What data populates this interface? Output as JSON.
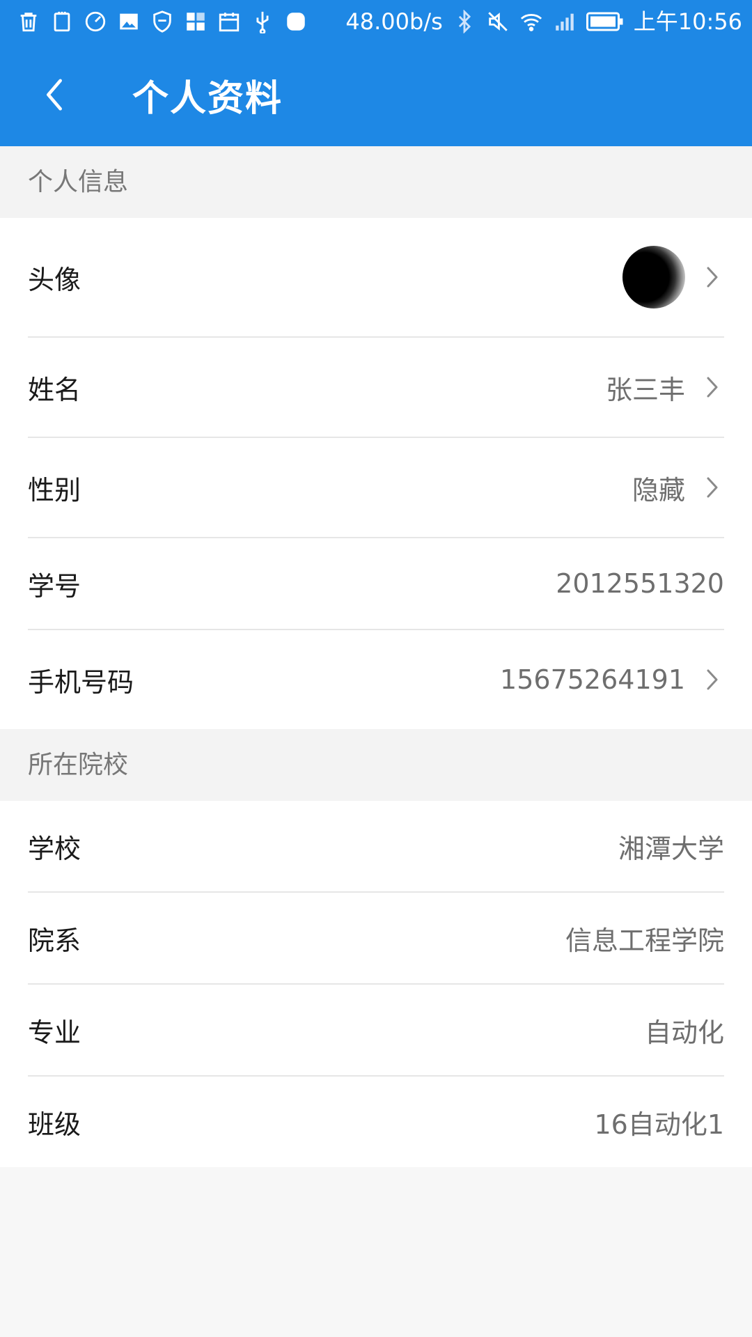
{
  "status_bar": {
    "speed": "48.00b/s",
    "time": "上午10:56",
    "icons_left": [
      "trash-icon",
      "clipboard-icon",
      "timer-icon",
      "image-icon",
      "shield-icon",
      "apps-icon",
      "calendar-icon",
      "usb-icon",
      "blob-icon"
    ],
    "icons_right": [
      "bluetooth-icon",
      "mute-icon",
      "wifi-icon",
      "signal-icon",
      "battery-icon"
    ]
  },
  "header": {
    "title": "个人资料",
    "back_icon": "chevron-left-icon",
    "color": "#1e88e5"
  },
  "sections": [
    {
      "title": "个人信息",
      "rows": [
        {
          "label": "头像",
          "value": "",
          "avatar": true,
          "arrow": true
        },
        {
          "label": "姓名",
          "value": "张三丰",
          "arrow": true
        },
        {
          "label": "性别",
          "value": "隐藏",
          "arrow": true
        },
        {
          "label": "学号",
          "value": "2012551320",
          "arrow": false
        },
        {
          "label": "手机号码",
          "value": "15675264191",
          "arrow": true
        }
      ]
    },
    {
      "title": "所在院校",
      "rows": [
        {
          "label": "学校",
          "value": "湘潭大学",
          "arrow": false
        },
        {
          "label": "院系",
          "value": "信息工程学院",
          "arrow": false
        },
        {
          "label": "专业",
          "value": "自动化",
          "arrow": false
        },
        {
          "label": "班级",
          "value": "16自动化1",
          "arrow": false
        }
      ]
    }
  ]
}
